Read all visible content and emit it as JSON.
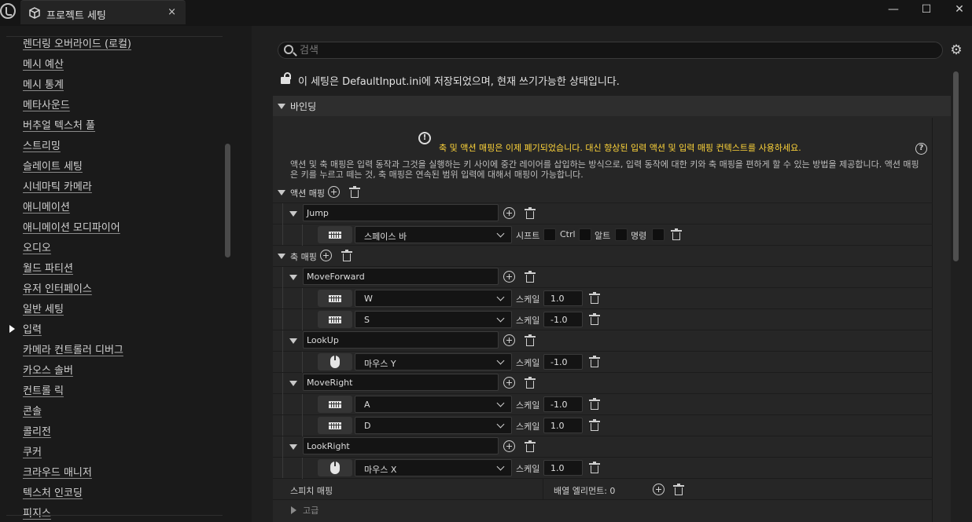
{
  "window": {
    "tab_title": "프로젝트 세팅",
    "tab_close": "×",
    "minimize": "—",
    "maximize": "☐",
    "close": "✕"
  },
  "nav": {
    "items": [
      "렌더링 오버라이드 (로컬)",
      "메시 예산",
      "메시 통계",
      "메타사운드",
      "버추얼 텍스처 풀",
      "스트리밍",
      "슬레이트 세팅",
      "시네마틱 카메라",
      "애니메이션",
      "애니메이션 모디파이어",
      "오디오",
      "월드 파티션",
      "유저 인터페이스",
      "일반 세팅",
      "입력",
      "카메라 컨트롤러 디버그",
      "카오스 솔버",
      "컨트롤 릭",
      "콘솔",
      "콜리전",
      "쿠커",
      "크라우드 매니저",
      "텍스처 인코딩",
      "피지스"
    ],
    "selected": "입력"
  },
  "search": {
    "placeholder": "검색"
  },
  "save_info": "이 세팅은 DefaultInput.ini에 저장되었으며, 현재 쓰기가능한 상태입니다.",
  "section": {
    "title": "바인딩"
  },
  "warning": "축 및 액션 매핑은 이제 폐기되었습니다. 대신 향상된 입력 액션 및 입력 매핑 컨텍스트를 사용하세요.",
  "description": "액션 및 축 매핑은 입력 동작과 그것을 실행하는 키 사이에 중간 레이어를 삽입하는 방식으로, 입력 동작에 대한 키와 축 매핑을 편하게 할 수 있는 방법을 제공합니다. 액션 매핑은 키를 누르고 떼는 것, 축 매핑은 연속된 범위 입력에 대해서 매핑이 가능합니다.",
  "action_mappings": {
    "label": "액션 매핑",
    "items": [
      {
        "name": "Jump",
        "key": "스페이스 바",
        "modifiers": [
          "시프트",
          "Ctrl",
          "알트",
          "명령"
        ]
      }
    ]
  },
  "axis_mappings": {
    "label": "축 매핑",
    "scale_label": "스케일",
    "items": [
      {
        "name": "MoveForward",
        "bindings": [
          {
            "key": "W",
            "scale": "1.0",
            "device": "keyboard"
          },
          {
            "key": "S",
            "scale": "-1.0",
            "device": "keyboard"
          }
        ]
      },
      {
        "name": "LookUp",
        "bindings": [
          {
            "key": "마우스 Y",
            "scale": "-1.0",
            "device": "mouse"
          }
        ]
      },
      {
        "name": "MoveRight",
        "bindings": [
          {
            "key": "A",
            "scale": "-1.0",
            "device": "keyboard"
          },
          {
            "key": "D",
            "scale": "1.0",
            "device": "keyboard"
          }
        ]
      },
      {
        "name": "LookRight",
        "bindings": [
          {
            "key": "마우스 X",
            "scale": "1.0",
            "device": "mouse"
          }
        ]
      }
    ]
  },
  "speech": {
    "label": "스피치 매핑",
    "array_elements": "배열 엘리먼트: 0"
  },
  "advanced": {
    "label": "고급"
  },
  "colors": {
    "warning": "#ffd53a",
    "background": "#1f1f1f",
    "panel": "#262626"
  }
}
